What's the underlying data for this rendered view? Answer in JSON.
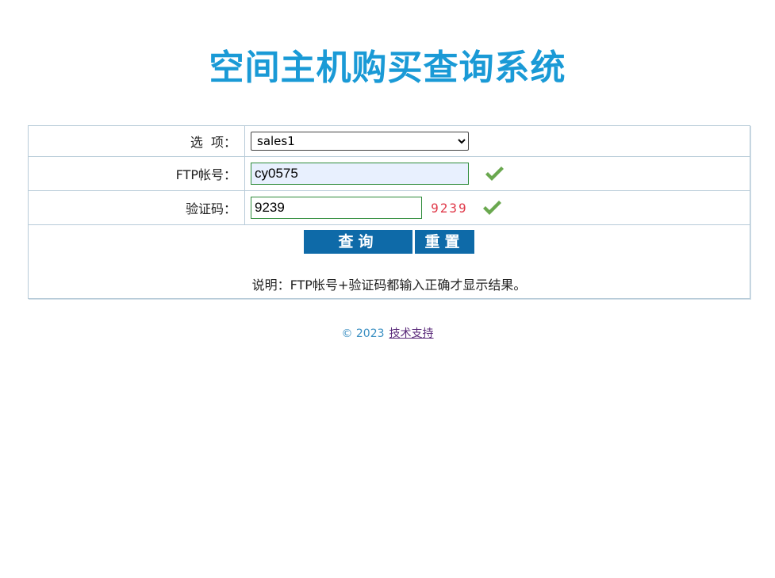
{
  "page": {
    "title": "空间主机购买查询系统"
  },
  "form": {
    "option_label": "选  项：",
    "option_selected": "sales1",
    "ftp_label": "FTP帐号：",
    "ftp_value": "cy0575",
    "code_label": "验证码：",
    "code_value": "9239",
    "captcha_text": "9239",
    "query_button": "查询",
    "reset_button": "重置",
    "note": "说明：FTP帐号+验证码都输入正确才显示结果。"
  },
  "footer": {
    "copyright": "© 2023",
    "support_link": "技术支持"
  },
  "colors": {
    "title": "#1a9ad6",
    "button": "#0e6aa8",
    "captcha": "#e03a4a",
    "check": "#6aa84f"
  },
  "icons": {
    "ftp_ok": "check-icon",
    "code_ok": "check-icon"
  }
}
